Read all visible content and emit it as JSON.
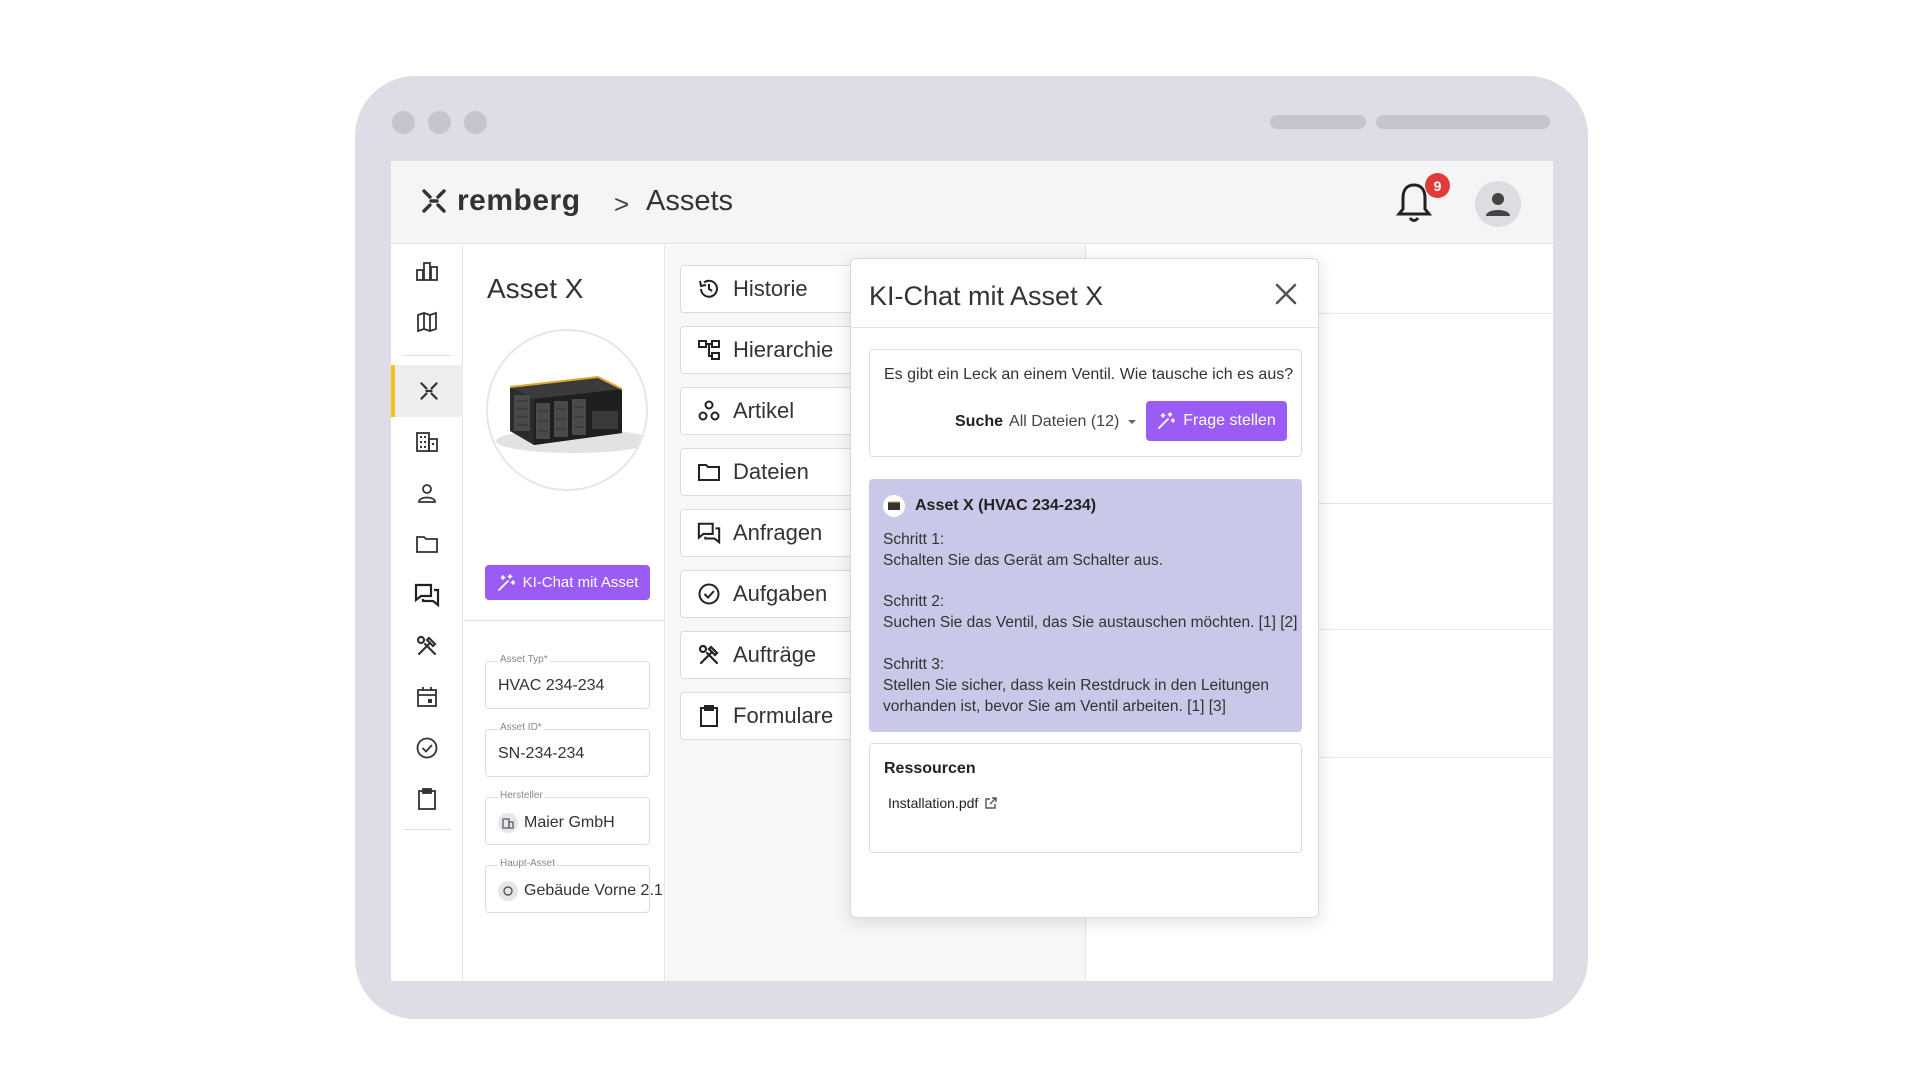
{
  "header": {
    "brand": "remberg",
    "breadcrumb_sep": ">",
    "breadcrumb": "Assets",
    "notification_count": "9"
  },
  "sidebar": {
    "items": [
      {
        "icon": "chart-icon"
      },
      {
        "icon": "map-icon"
      },
      {
        "icon": "assets-icon",
        "active": true
      },
      {
        "icon": "building-icon"
      },
      {
        "icon": "person-icon"
      },
      {
        "icon": "folder-icon"
      },
      {
        "icon": "chat-icon"
      },
      {
        "icon": "tools-icon"
      },
      {
        "icon": "calendar-icon"
      },
      {
        "icon": "check-icon"
      },
      {
        "icon": "clipboard-icon"
      }
    ],
    "accent_color": "#f0c419"
  },
  "asset": {
    "title": "Asset X",
    "ki_button": "KI-Chat mit Asset",
    "fields": [
      {
        "label": "Asset Typ*",
        "value": "HVAC 234-234"
      },
      {
        "label": "Asset ID*",
        "value": "SN-234-234"
      },
      {
        "label": "Hersteller",
        "value": "Maier GmbH"
      },
      {
        "label": "Haupt-Asset",
        "value": "Gebäude Vorne 2.1"
      }
    ]
  },
  "menu": {
    "items": [
      {
        "label": "Historie",
        "icon": "history-icon"
      },
      {
        "label": "Hierarchie",
        "icon": "hierarchy-icon"
      },
      {
        "label": "Artikel",
        "icon": "parts-icon"
      },
      {
        "label": "Dateien",
        "icon": "folder-icon"
      },
      {
        "label": "Anfragen",
        "icon": "chat-icon"
      },
      {
        "label": "Aufgaben",
        "icon": "check-icon"
      },
      {
        "label": "Aufträge",
        "icon": "tools-icon"
      },
      {
        "label": "Formulare",
        "icon": "clipboard-icon"
      }
    ]
  },
  "chat": {
    "title": "KI-Chat mit Asset X",
    "question": "Es gibt ein Leck an einem Ventil. Wie tausche ich es aus?",
    "search_label": "Suche",
    "search_value": "All Dateien (12)",
    "ask_button": "Frage stellen",
    "answer_header": "Asset X (HVAC 234-234)",
    "steps": [
      {
        "title": "Schritt 1:",
        "text": "Schalten Sie das Gerät am Schalter aus."
      },
      {
        "title": "Schritt 2:",
        "text": "Suchen Sie das Ventil, das Sie austauschen möchten. [1] [2]"
      },
      {
        "title": "Schritt 3:",
        "text": "Stellen Sie sicher, dass kein Restdruck in den Leitungen vorhanden ist, bevor Sie am Ventil arbeiten. [1] [3]"
      }
    ],
    "resources_title": "Ressourcen",
    "resource_link": "Installation.pdf",
    "primary_color": "#9a5cf5",
    "answer_bg": "#c9c8e8"
  }
}
